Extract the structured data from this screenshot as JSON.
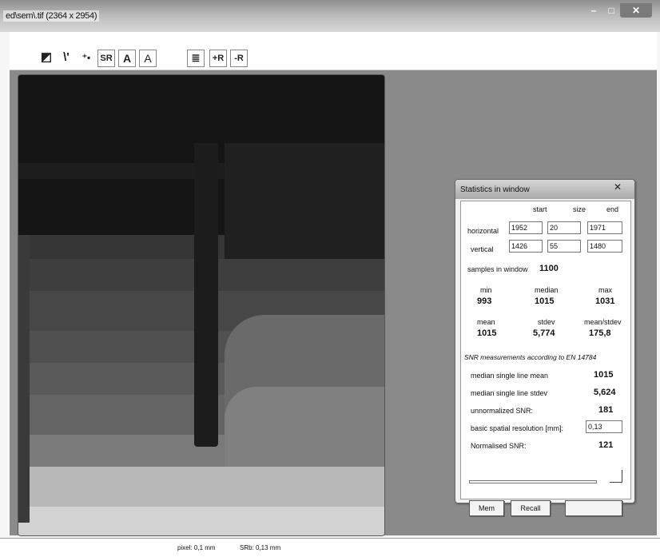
{
  "window": {
    "title": "ed\\sem\\.tif (2364 x 2954)"
  },
  "toolbar": {
    "buttons": [
      {
        "name": "image-icon",
        "label": "◩"
      },
      {
        "name": "line-profile-icon",
        "label": "\\'"
      },
      {
        "name": "region-icon",
        "label": "⁺▪"
      },
      {
        "name": "srb-button",
        "label": "SR"
      },
      {
        "name": "annotate-a-button",
        "label": "A"
      },
      {
        "name": "annotate-a-plain-button",
        "label": "A"
      },
      {
        "name": "list-button",
        "label": "≣"
      },
      {
        "name": "plus-r-button",
        "label": "+R"
      },
      {
        "name": "minus-r-button",
        "label": "-R"
      }
    ]
  },
  "stats": {
    "title": "Statistics in window",
    "col_start": "start",
    "col_size": "size",
    "col_end": "end",
    "horizontal_label": "horizontal",
    "vertical_label": "vertical",
    "h_start": "1952",
    "h_size": "20",
    "h_end": "1971",
    "v_start": "1426",
    "v_size": "55",
    "v_end": "1480",
    "samples_label": "samples in window",
    "samples_value": "1100",
    "min_label": "min",
    "min_value": "993",
    "median_label": "median",
    "median_value": "1015",
    "max_label": "max",
    "max_value": "1031",
    "mean_label": "mean",
    "mean_value": "1015",
    "stdev_label": "stdev",
    "stdev_value": "5,774",
    "meanstdev_label": "mean/stdev",
    "meanstdev_value": "175,8",
    "snr_heading": "SNR measurements according to EN 14784",
    "median_line_mean_label": "median single line mean",
    "median_line_mean_value": "1015",
    "median_line_stdev_label": "median single line stdev",
    "median_line_stdev_value": "5,624",
    "unnormalized_label": "unnormalized SNR:",
    "unnormalized_value": "181",
    "basic_res_label": "basic spatial resolution [mm]:",
    "basic_res_value": "0,13",
    "normalized_label": "Normalised SNR:",
    "normalized_value": "121",
    "mem_label": "Mem",
    "recall_label": "Recall"
  },
  "status": {
    "pixel": "pixel: 0,1 mm",
    "srb": "SRb: 0,13 mm"
  }
}
